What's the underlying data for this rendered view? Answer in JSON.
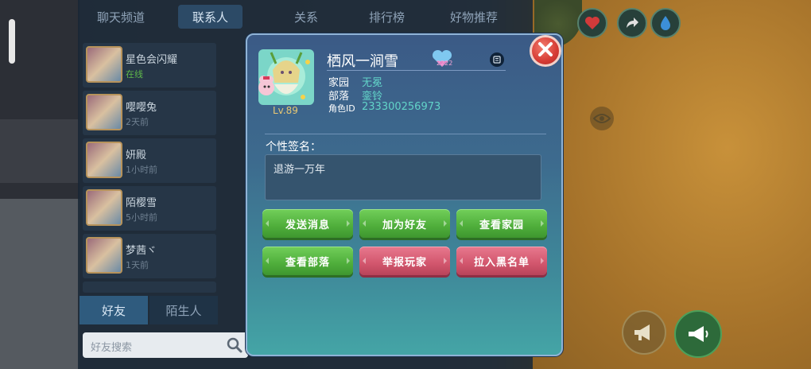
{
  "friend_panel": {
    "top_tabs": [
      "聊天频道",
      "联系人",
      "关系",
      "排行榜",
      "好物推荐"
    ],
    "active_tab": "联系人",
    "contacts": [
      {
        "name": "星色会闪耀",
        "status": "在线"
      },
      {
        "name": "嘤嘤兔",
        "status": "2天前"
      },
      {
        "name": "妍殿",
        "status": "1小时前"
      },
      {
        "name": "陌樱雪",
        "status": "5小时前"
      },
      {
        "name": "梦茜ヾ",
        "status": "1天前"
      }
    ],
    "bottom_tabs": [
      "好友",
      "陌生人"
    ],
    "search_placeholder": "好友搜索"
  },
  "profile": {
    "player_name": "栖风一涧雪",
    "level": "Lv.89",
    "badge_count": "2222",
    "homeland_label": "家园",
    "homeland_value": "无冕",
    "tribe_label": "部落",
    "tribe_value": "銮铃",
    "role_id_label": "角色ID",
    "role_id_value": "233300256973",
    "signature_label": "个性签名：",
    "signature_text": "退游一万年"
  },
  "actions": {
    "send_message": "发送消息",
    "add_friend": "加为好友",
    "view_homeland": "查看家园",
    "view_tribe": "查看部落",
    "report_player": "举报玩家",
    "blacklist": "拉入黑名单"
  },
  "icons": [
    "close-icon",
    "memo-icon",
    "heart-icon",
    "share-icon",
    "drop-icon",
    "eye-icon",
    "megaphone-icon",
    "mic-icon",
    "search-icon"
  ],
  "colors": {
    "accent_green": "#4fae3b",
    "accent_red": "#d2566d",
    "value_teal": "#62d3c8",
    "close_red": "#d63b34"
  }
}
